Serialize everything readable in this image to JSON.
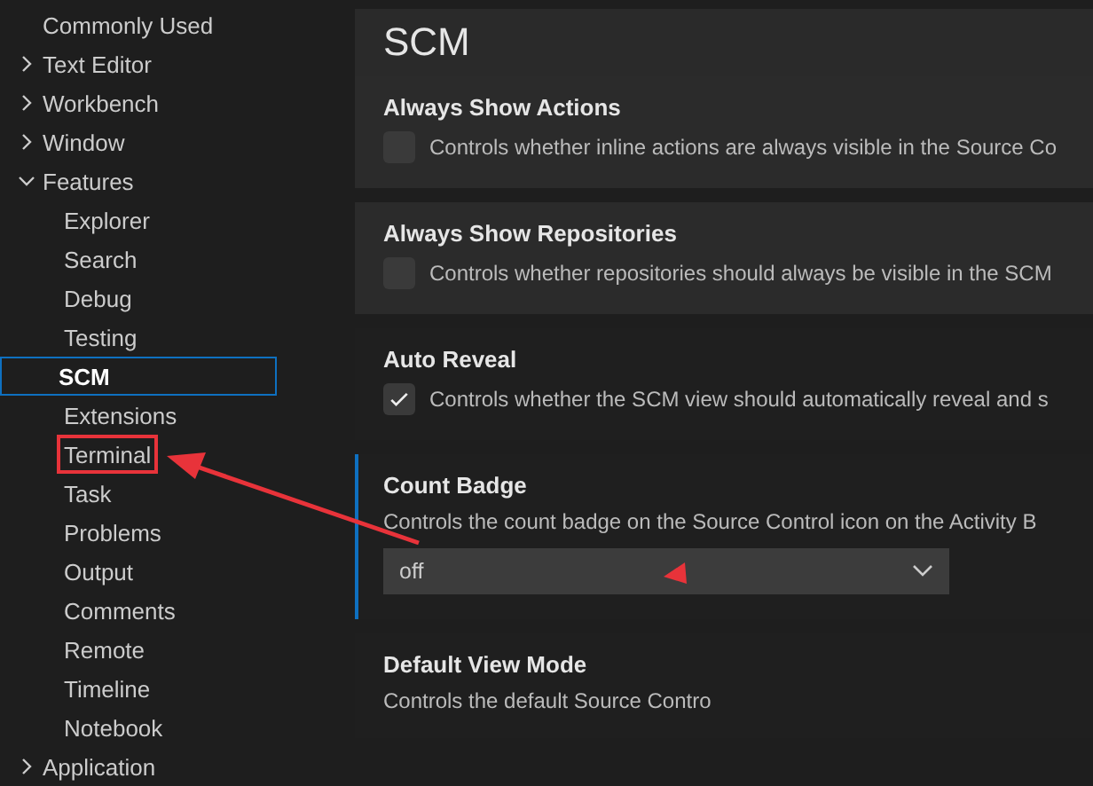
{
  "tree": [
    {
      "label": "Commonly Used"
    },
    {
      "label": "Text Editor",
      "expanded": false
    },
    {
      "label": "Workbench",
      "expanded": false
    },
    {
      "label": "Window",
      "expanded": false
    },
    {
      "label": "Features",
      "expanded": true,
      "children": [
        {
          "label": "Explorer",
          "selected": false,
          "highlighted": false
        },
        {
          "label": "Search",
          "selected": false,
          "highlighted": false
        },
        {
          "label": "Debug",
          "selected": false,
          "highlighted": false
        },
        {
          "label": "Testing",
          "selected": false,
          "highlighted": false
        },
        {
          "label": "SCM",
          "selected": true,
          "highlighted": false
        },
        {
          "label": "Extensions",
          "selected": false,
          "highlighted": false
        },
        {
          "label": "Terminal",
          "selected": false,
          "highlighted": true
        },
        {
          "label": "Task",
          "selected": false,
          "highlighted": false
        },
        {
          "label": "Problems",
          "selected": false,
          "highlighted": false
        },
        {
          "label": "Output",
          "selected": false,
          "highlighted": false
        },
        {
          "label": "Comments",
          "selected": false,
          "highlighted": false
        },
        {
          "label": "Remote",
          "selected": false,
          "highlighted": false
        },
        {
          "label": "Timeline",
          "selected": false,
          "highlighted": false
        },
        {
          "label": "Notebook",
          "selected": false,
          "highlighted": false
        }
      ]
    },
    {
      "label": "Application",
      "expanded": false
    }
  ],
  "section_title": "SCM",
  "settings": [
    {
      "kind": "checkbox",
      "title": "Always Show Actions",
      "description": "Controls whether inline actions are always visible in the Source Co",
      "checked": false,
      "focused": false,
      "hovered": true
    },
    {
      "kind": "checkbox",
      "title": "Always Show Repositories",
      "description": "Controls whether repositories should always be visible in the SCM",
      "checked": false,
      "focused": false,
      "hovered": true
    },
    {
      "kind": "checkbox",
      "title": "Auto Reveal",
      "description": "Controls whether the SCM view should automatically reveal and s",
      "checked": true,
      "focused": false,
      "hovered": false
    },
    {
      "kind": "dropdown",
      "title": "Count Badge",
      "description": "Controls the count badge on the Source Control icon on the Activity B",
      "value": "off",
      "focused": true,
      "hovered": false
    },
    {
      "kind": "text",
      "title": "Default View Mode",
      "description": "Controls the default Source Contro",
      "focused": false,
      "hovered": false
    }
  ]
}
